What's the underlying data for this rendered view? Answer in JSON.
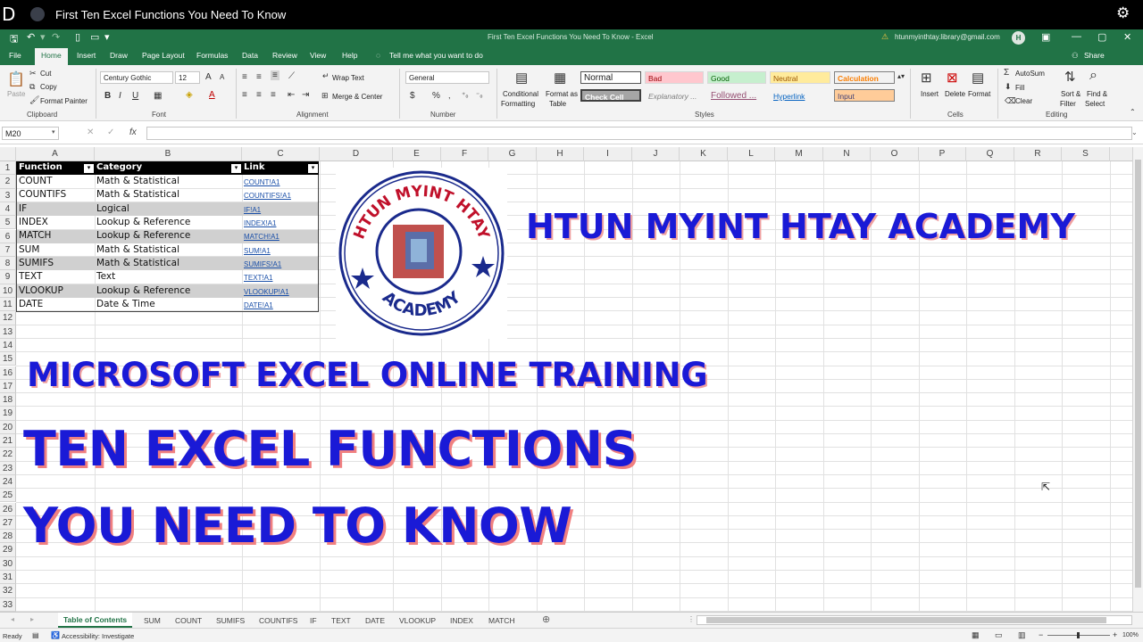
{
  "topbar": {
    "logo": "D",
    "title": "First Ten Excel Functions You Need To Know"
  },
  "titlebar": {
    "window_title": "First Ten Excel Functions You Need To Know  -  Excel",
    "email": "htunmyinthtay.library@gmail.com",
    "avatar": "H"
  },
  "menu": [
    "File",
    "Home",
    "Insert",
    "Draw",
    "Page Layout",
    "Formulas",
    "Data",
    "Review",
    "View",
    "Help"
  ],
  "tell_me": "Tell me what you want to do",
  "share": "Share",
  "ribbon": {
    "clipboard": {
      "paste": "Paste",
      "cut": "Cut",
      "copy": "Copy",
      "format_painter": "Format Painter",
      "label": "Clipboard"
    },
    "font": {
      "name": "Century Gothic",
      "size": "12",
      "label": "Font"
    },
    "alignment": {
      "wrap": "Wrap Text",
      "merge": "Merge & Center",
      "label": "Alignment"
    },
    "number": {
      "format": "General",
      "label": "Number"
    },
    "styles": {
      "conditional": "Conditional",
      "formatting": "Formatting",
      "format_as": "Format as",
      "table": "Table",
      "cells": [
        "Normal",
        "Bad",
        "Good",
        "Neutral",
        "Calculation",
        "Check Cell",
        "Explanatory ...",
        "Followed ...",
        "Hyperlink",
        "Input"
      ],
      "label": "Styles"
    },
    "cells": {
      "insert": "Insert",
      "delete": "Delete",
      "format": "Format",
      "label": "Cells"
    },
    "editing": {
      "autosum": "AutoSum",
      "fill": "Fill",
      "clear": "Clear",
      "sort1": "Sort &",
      "sort2": "Filter",
      "find1": "Find &",
      "find2": "Select",
      "label": "Editing"
    }
  },
  "formula_bar": {
    "name_box": "M20",
    "fx": "fx",
    "value": ""
  },
  "columns": [
    "A",
    "B",
    "C",
    "D",
    "E",
    "F",
    "G",
    "H",
    "I",
    "J",
    "K",
    "L",
    "M",
    "N",
    "O",
    "P",
    "Q",
    "R",
    "S"
  ],
  "rows": [
    "1",
    "2",
    "3",
    "4",
    "5",
    "6",
    "7",
    "8",
    "9",
    "10",
    "11",
    "12",
    "13",
    "14",
    "15",
    "16",
    "17",
    "18",
    "19",
    "20",
    "21",
    "22",
    "23",
    "24",
    "25",
    "26",
    "27",
    "28",
    "29",
    "30",
    "31",
    "32",
    "33"
  ],
  "table": {
    "headers": [
      "Function",
      "Category",
      "Link"
    ],
    "rows": [
      [
        "COUNT",
        "Math & Statistical",
        "COUNT!A1"
      ],
      [
        "COUNTIFS",
        "Math & Statistical",
        "COUNTIFS!A1"
      ],
      [
        "IF",
        "Logical",
        "IF!A1"
      ],
      [
        "INDEX",
        "Lookup & Reference",
        "INDEX!A1"
      ],
      [
        "MATCH",
        "Lookup & Reference",
        "MATCH!A1"
      ],
      [
        "SUM",
        "Math & Statistical",
        "SUM!A1"
      ],
      [
        "SUMIFS",
        "Math & Statistical",
        "SUMIFS!A1"
      ],
      [
        "TEXT",
        "Text",
        "TEXT!A1"
      ],
      [
        "VLOOKUP",
        "Lookup & Reference",
        "VLOOKUP!A1"
      ],
      [
        "DATE",
        "Date & Time",
        "DATE!A1"
      ]
    ]
  },
  "logo": {
    "top": "HTUN MYINT HTAY",
    "bottom": "ACADEMY"
  },
  "overlay": {
    "academy": "HTUN MYINT HTAY ACADEMY",
    "training": "MICROSOFT EXCEL ONLINE TRAINING",
    "line1": "TEN EXCEL FUNCTIONS",
    "line2": "YOU NEED TO KNOW"
  },
  "sheet_tabs": [
    "Table of Contents",
    "SUM",
    "COUNT",
    "SUMIFS",
    "COUNTIFS",
    "IF",
    "TEXT",
    "DATE",
    "VLOOKUP",
    "INDEX",
    "MATCH"
  ],
  "status": {
    "ready": "Ready",
    "accessibility": "Accessibility: Investigate",
    "zoom": "100%"
  },
  "colors": {
    "excel_green": "#217346",
    "title_blue": "#1a1ad6",
    "table_header": "#000000",
    "row_band": "#d0d0d0"
  }
}
